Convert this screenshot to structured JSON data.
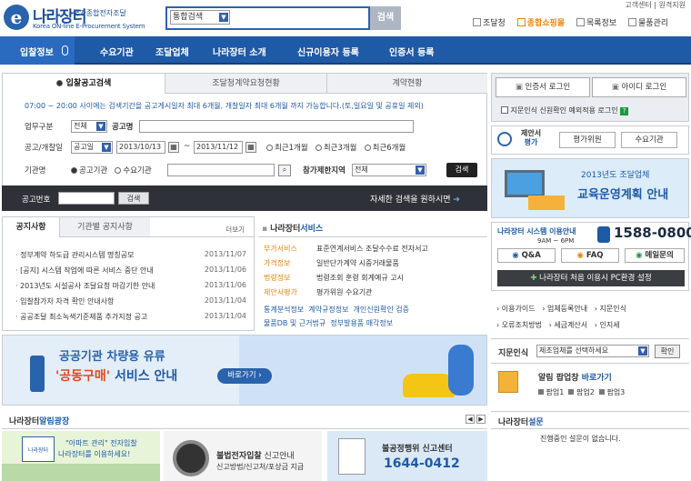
{
  "header": {
    "logo_mark": "e",
    "logo_title": "나라장터",
    "logo_sub": "국가종합전자조달",
    "logo_en": "Korea ON-line E-Procurement System",
    "search_scope": "통합검색",
    "search_button": "검색",
    "top_links": "고객센터 | 원격지원",
    "shortcuts": [
      "조달청",
      "종합쇼핑몰",
      "목록정보",
      "물품관리"
    ]
  },
  "nav": {
    "items": [
      "입찰정보",
      "수요기관",
      "조달업체",
      "나라장터 소개",
      "신규이용자 등록",
      "인증서 등록"
    ]
  },
  "search_tabs": [
    "입찰공고검색",
    "조달청계약요청현황",
    "계약현황"
  ],
  "search_form": {
    "notice": "07:00 ~ 20:00 사이에는 검색기간을 공고게시일자 최대 6개월, 개찰일자 최대 6개월 까지 가능합니다.(토,일요일 및 공휴일 제외)",
    "category_label": "업무구분",
    "category_value": "전체",
    "name_label": "공고명",
    "date_label": "공고/개찰일",
    "date_type": "공고일",
    "date_from": "2013/10/13",
    "date_tilde": "~",
    "date_to": "2013/11/12",
    "date_options": [
      "최근1개월",
      "최근3개월",
      "최근6개월"
    ],
    "org_label": "기관명",
    "org_options": [
      "공고기관",
      "수요기관"
    ],
    "region_label": "참가제한지역",
    "region_value": "전체",
    "search_button": "검색",
    "number_label": "공고번호",
    "number_button": "검색",
    "detail_link": "자세한 검색을 원하시면"
  },
  "notices": {
    "tabs": [
      "공지사항",
      "기관별 공지사항"
    ],
    "more": "더보기",
    "items": [
      {
        "title": "정부계약 하도급 관리시스템 명칭공모",
        "date": "2013/11/07"
      },
      {
        "title": "[공지] 시스템 작업에 따른 서비스 중단 안내",
        "date": "2013/11/06"
      },
      {
        "title": "2013년도 시설공사 조달요청 마감기한 안내",
        "date": "2013/11/06"
      },
      {
        "title": "입찰참가자 자격 확인 안내사항",
        "date": "2013/11/04"
      },
      {
        "title": "공공조달 최소녹색기준제품 추가지정 공고",
        "date": "2013/11/04"
      }
    ]
  },
  "services": {
    "title_a": "나라장터",
    "title_b": "서비스",
    "rows": [
      {
        "label": "부가서비스",
        "items": [
          "표준연계서비스 조달수수료 전자서고"
        ]
      },
      {
        "label": "가격정보",
        "items": [
          "일반단가계약 시중거래물품"
        ]
      },
      {
        "label": "법령정보",
        "items": [
          "법령조회",
          "훈령",
          "회계예규",
          "고시"
        ]
      },
      {
        "label": "제안서평가",
        "items": [
          "평가위원 수요기관"
        ]
      }
    ],
    "links": [
      "통계분석정보",
      "계약규정정보",
      "개인신원확인 검증",
      "물품DB 및 근거법규",
      "정부발용품 매각정보"
    ]
  },
  "banner": {
    "line1": "공공기관 차량용 유류",
    "line2_pre": "'공동구매'",
    "line2_post": " 서비스 안내",
    "button": "바로가기"
  },
  "promo": {
    "title_a": "나라장터",
    "title_b": "알림광장",
    "cards": [
      {
        "logo": "나라장터",
        "l1": "\"아파트 관리\" 전자입찰",
        "l2": "나라장터를 이용하세요!"
      },
      {
        "l1": "불법전자입찰",
        "l1b": " 신고안내",
        "l2": "신고방법/신고처/포상금 지급"
      },
      {
        "l1": "불공정행위 신고센터",
        "l2": "1644-0412"
      }
    ]
  },
  "right": {
    "login_cert": "인증서 로그인",
    "login_id": "아이디 로그인",
    "checkbox_label": "지문인식 신원확인 예외적용 로그인",
    "eval_title": "제안서",
    "eval_sub": "평가",
    "eval_btn1": "평가위원",
    "eval_btn2": "수요기관",
    "edu_year": "2013년도 조달업체",
    "edu_title": "교육운영계획 안내",
    "help_title": "나라장터 시스템 이용안내",
    "help_hours": "9AM ~ 6PM",
    "help_phone": "1588-0800",
    "help_btns": [
      "Q&A",
      "FAQ",
      "메일문의"
    ],
    "first_use": "나라장터 처음 이용시 PC환경 설정",
    "links": [
      "이용가이드",
      "업체등록안내",
      "지문인식",
      "오류조치방법",
      "세금계산서",
      "인지세"
    ],
    "finger_label": "지문인식",
    "finger_select": "제조업체를 선택하세요",
    "finger_btn": "확인",
    "popup_title": "알림 팝업창",
    "popup_link": "바로가기",
    "popups": [
      "팝업1",
      "팝업2",
      "팝업3"
    ],
    "survey_a": "나라장터",
    "survey_b": "설문",
    "survey_text": "진행중인 설문이 없습니다."
  },
  "colors": {
    "brand": "#1f5aa6",
    "accent": "#e8830c",
    "dark": "#2e3137",
    "green": "#1a9a3c"
  }
}
